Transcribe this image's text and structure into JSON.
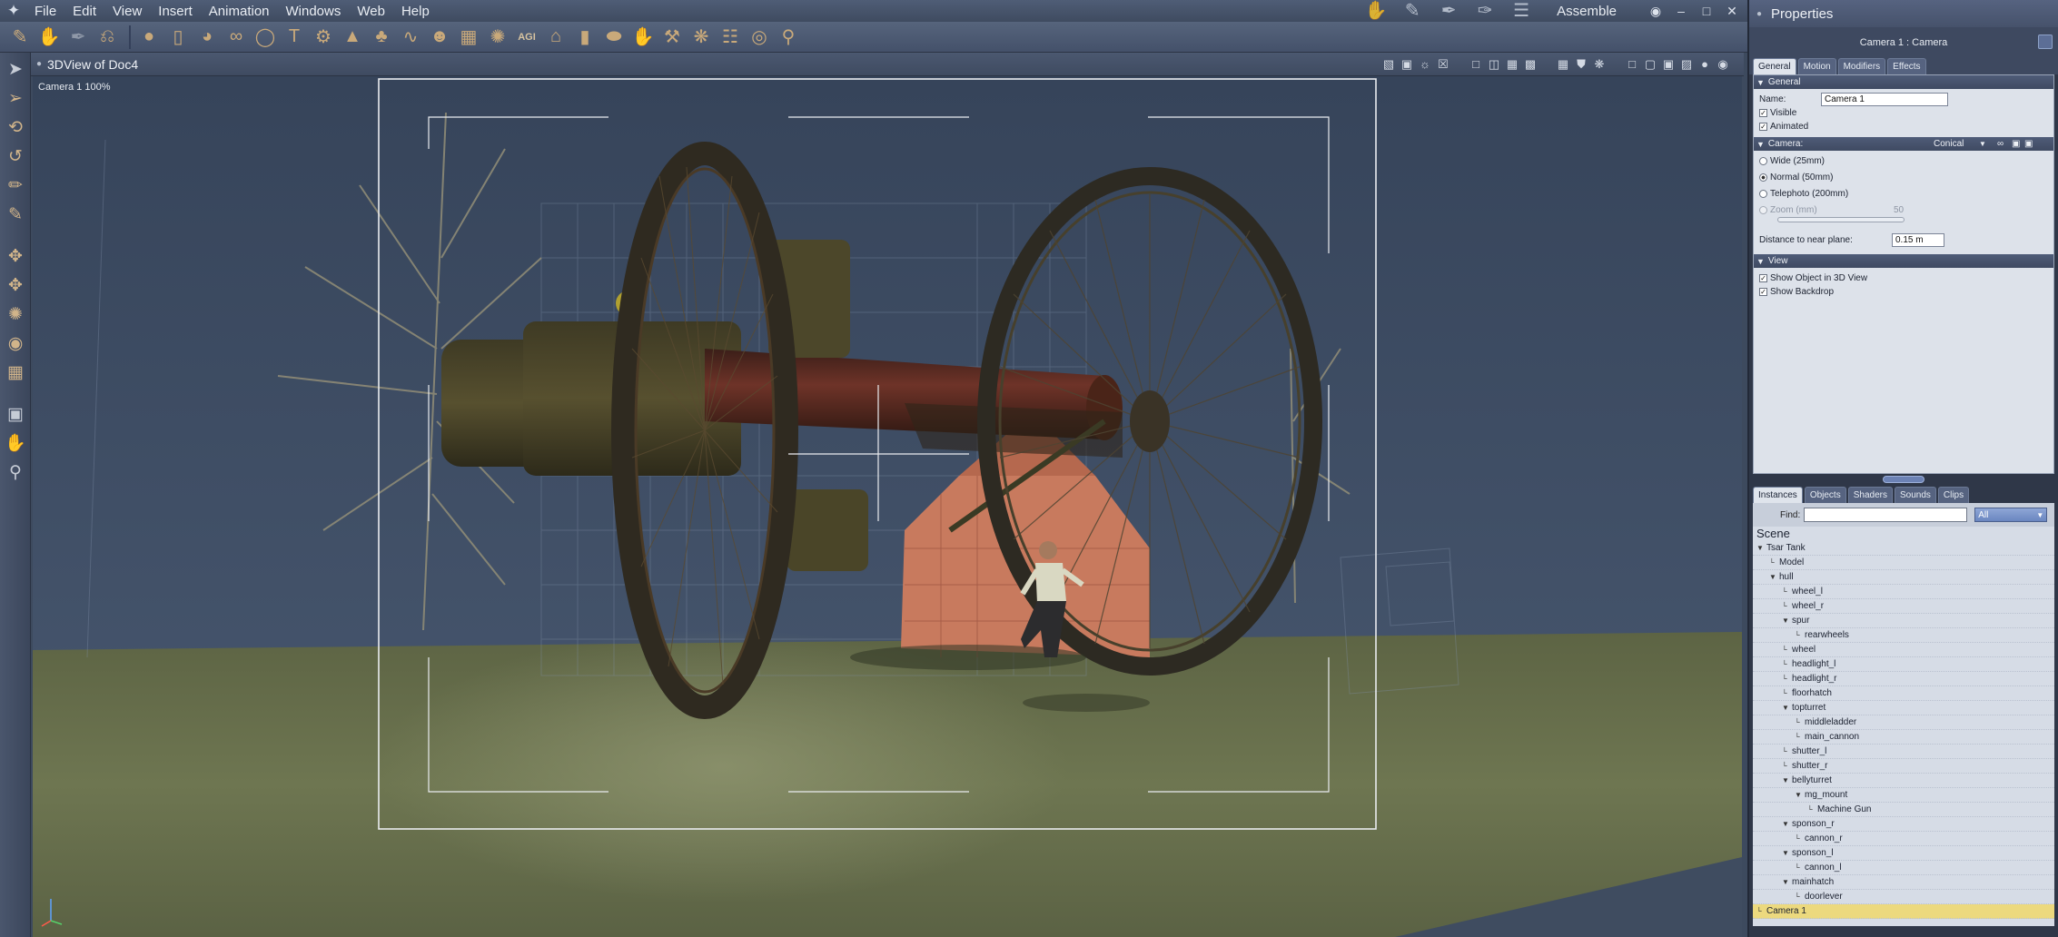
{
  "menubar": {
    "items": [
      "File",
      "Edit",
      "View",
      "Insert",
      "Animation",
      "Windows",
      "Web",
      "Help"
    ],
    "room_label": "Assemble",
    "window_controls": [
      "◉",
      "–",
      "□",
      "✕"
    ]
  },
  "toolbar": {
    "agi_label": "AGI"
  },
  "viewport": {
    "title": "3DView of Doc4",
    "camera_label": "Camera 1 100%"
  },
  "properties": {
    "panel_title": "Properties",
    "object_title": "Camera 1 : Camera",
    "tabs": [
      "General",
      "Motion",
      "Modifiers",
      "Effects"
    ],
    "general": {
      "section": "General",
      "name_label": "Name:",
      "name_value": "Camera 1",
      "visible_label": "Visible",
      "animated_label": "Animated"
    },
    "camera": {
      "section": "Camera:",
      "type": "Conical",
      "lenses": [
        "Wide (25mm)",
        "Normal (50mm)",
        "Telephoto (200mm)"
      ],
      "zoom_label": "Zoom (mm)",
      "zoom_value": "50",
      "near_plane_label": "Distance to near plane:",
      "near_plane_value": "0.15 m"
    },
    "view": {
      "section": "View",
      "show_object_label": "Show Object in 3D View",
      "show_backdrop_label": "Show Backdrop"
    }
  },
  "instances": {
    "tabs": [
      "Instances",
      "Objects",
      "Shaders",
      "Sounds",
      "Clips"
    ],
    "find_label": "Find:",
    "filter_value": "All",
    "scene_label": "Scene",
    "tree": [
      {
        "label": "Tsar Tank",
        "expanded": true
      },
      {
        "label": "Model",
        "expanded": false
      },
      {
        "label": "hull",
        "expanded": true
      },
      {
        "label": "wheel_l",
        "expanded": false
      },
      {
        "label": "wheel_r",
        "expanded": false
      },
      {
        "label": "spur",
        "expanded": true
      },
      {
        "label": "rearwheels",
        "expanded": false
      },
      {
        "label": "wheel",
        "expanded": false
      },
      {
        "label": "headlight_l",
        "expanded": false
      },
      {
        "label": "headlight_r",
        "expanded": false
      },
      {
        "label": "floorhatch",
        "expanded": false
      },
      {
        "label": "topturret",
        "expanded": true
      },
      {
        "label": "middleladder",
        "expanded": false
      },
      {
        "label": "main_cannon",
        "expanded": false
      },
      {
        "label": "shutter_l",
        "expanded": false
      },
      {
        "label": "shutter_r",
        "expanded": false
      },
      {
        "label": "bellyturret",
        "expanded": true
      },
      {
        "label": "mg_mount",
        "expanded": true
      },
      {
        "label": "Machine Gun",
        "expanded": false
      },
      {
        "label": "sponson_r",
        "expanded": true
      },
      {
        "label": "cannon_r",
        "expanded": false
      },
      {
        "label": "sponson_l",
        "expanded": true
      },
      {
        "label": "cannon_l",
        "expanded": false
      },
      {
        "label": "mainhatch",
        "expanded": true
      },
      {
        "label": "doorlever",
        "expanded": false
      },
      {
        "label": "Camera 1",
        "expanded": false
      }
    ]
  }
}
